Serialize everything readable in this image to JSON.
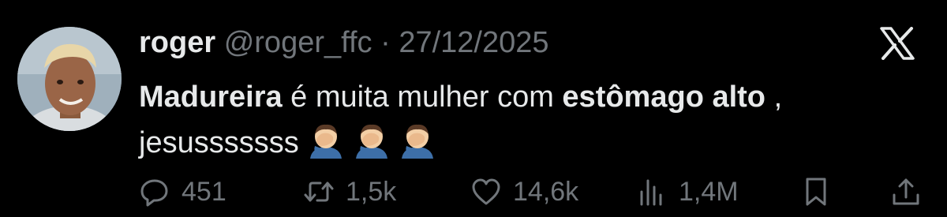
{
  "tweet": {
    "author_name": "roger",
    "handle": "@roger_ffc",
    "separator": "·",
    "date": "27/12/2025",
    "text_part1": "Madureira",
    "text_part2": " é muita mulher com ",
    "text_part3": "estômago alto",
    "text_part4": " ,",
    "text_line2": "jesusssssss",
    "emoji_names": [
      "man-facepalming-emoji",
      "man-facepalming-emoji",
      "man-facepalming-emoji"
    ]
  },
  "stats": {
    "replies": "451",
    "retweets": "1,5k",
    "likes": "14,6k",
    "views": "1,4M"
  },
  "icons": {
    "reply": "reply-icon",
    "retweet": "retweet-icon",
    "like": "heart-icon",
    "views": "views-icon",
    "bookmark": "bookmark-icon",
    "share": "share-icon",
    "logo": "x-logo-icon"
  },
  "colors": {
    "background": "#000000",
    "text": "#e7e9ea",
    "muted": "#71767b"
  }
}
